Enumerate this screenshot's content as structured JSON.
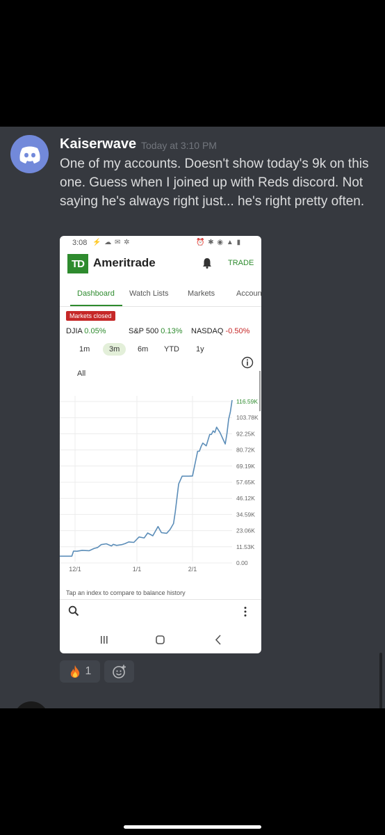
{
  "message": {
    "username": "Kaiserwave",
    "timestamp": "Today at 3:10 PM",
    "text": "One of my accounts. Doesn't show today's 9k on this one. Guess when I joined up with Reds discord. Not saying he's always right just... he's right pretty often."
  },
  "screenshot": {
    "status_time": "3:08",
    "brand": "Ameritrade",
    "logo_text": "TD",
    "trade_label": "TRADE",
    "tabs": [
      "Dashboard",
      "Watch Lists",
      "Markets",
      "Accoun"
    ],
    "markets_badge": "Markets closed",
    "indices": [
      {
        "name": "DJIA",
        "change": "0.05%"
      },
      {
        "name": "S&P 500",
        "change": "0.13%"
      },
      {
        "name": "NASDAQ",
        "change": "-0.50%"
      }
    ],
    "ranges": [
      "1m",
      "3m",
      "6m",
      "YTD",
      "1y",
      "All"
    ],
    "selected_range": "3m",
    "hint": "Tap an index to compare to balance history"
  },
  "chart_data": {
    "type": "line",
    "y_tick_labels": [
      "116.59K",
      "103.78K",
      "92.25K",
      "80.72K",
      "69.19K",
      "57.65K",
      "46.12K",
      "34.59K",
      "23.06K",
      "11.53K",
      "0.00"
    ],
    "x_tick_labels": [
      "12/1",
      "1/1",
      "2/1"
    ],
    "ylim": [
      0,
      116590
    ],
    "highlight_label": "116.59K",
    "x": [
      0,
      4,
      7,
      8,
      10,
      13,
      17,
      20,
      22,
      24,
      27,
      30,
      31,
      33,
      36,
      38,
      40,
      43,
      46,
      49,
      51,
      54,
      57,
      59,
      62,
      64,
      66,
      67,
      69,
      71,
      73,
      75,
      77,
      80,
      81,
      82,
      83,
      85,
      87,
      88,
      89,
      90,
      91,
      93,
      96,
      97,
      98,
      99,
      100
    ],
    "y": [
      1900,
      1900,
      1900,
      5600,
      5500,
      6200,
      5900,
      7600,
      8300,
      10400,
      11000,
      9400,
      10600,
      9800,
      10400,
      11200,
      12400,
      12000,
      16000,
      15300,
      18900,
      16900,
      23700,
      19200,
      18700,
      21500,
      25900,
      34400,
      55000,
      60700,
      60700,
      60700,
      60800,
      79000,
      79000,
      82500,
      85000,
      83000,
      91400,
      91400,
      94000,
      92800,
      96700,
      92700,
      84300,
      92100,
      102500,
      108000,
      116590
    ]
  },
  "reactions": [
    {
      "emoji": "fire",
      "count": "1"
    }
  ],
  "colors": {
    "background": "#36393f",
    "blurple": "#7289da",
    "td_green": "#2e8b2e",
    "line": "#5b8db8"
  }
}
